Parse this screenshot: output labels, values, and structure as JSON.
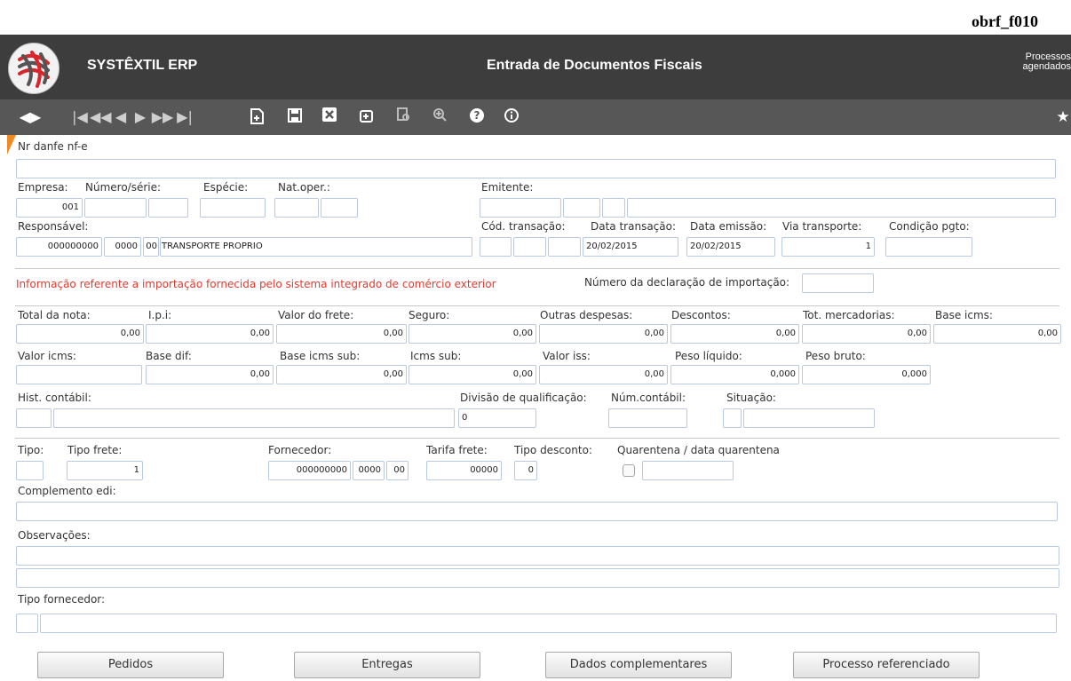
{
  "screen_code": "obrf_f010",
  "header": {
    "brand": "SYSTÊXTIL ERP",
    "title": "Entrada de Documentos Fiscais",
    "processes_line1": "Processos",
    "processes_line2": "agendados"
  },
  "toolbar": {
    "icons": [
      "nav-prev-next-icon",
      "first-record-icon",
      "prev-page-icon",
      "prev-record-icon",
      "next-record-icon",
      "next-page-icon",
      "last-record-icon",
      "new-record-icon",
      "save-icon",
      "delete-icon",
      "add-detail-icon",
      "report-icon",
      "zoom-icon",
      "help-icon",
      "info-icon",
      "favorite-star-icon"
    ]
  },
  "form": {
    "nr_danfe": {
      "label": "Nr danfe nf-e",
      "value": ""
    },
    "empresa": {
      "label": "Empresa:",
      "value": "001"
    },
    "numero_serie": {
      "label": "Número/série:"
    },
    "especie": {
      "label": "Espécie:"
    },
    "nat_oper": {
      "label": "Nat.oper.:"
    },
    "emitente": {
      "label": "Emitente:"
    },
    "responsavel": {
      "label": "Responsável:",
      "code": "000000000",
      "sub": "0000",
      "seq": "00",
      "name": "TRANSPORTE PROPRIO"
    },
    "cod_transacao": {
      "label": "Cód. transação:"
    },
    "data_transacao": {
      "label": "Data transação:",
      "value": "20/02/2015"
    },
    "data_emissao": {
      "label": "Data emissão:",
      "value": "20/02/2015"
    },
    "via_transporte": {
      "label": "Via transporte:",
      "value": "1"
    },
    "condicao_pgto": {
      "label": "Condição pgto:"
    },
    "import_warning": "Informação referente a importação fornecida pelo sistema integrado de comércio exterior",
    "num_declaracao": {
      "label": "Número da declaração de importação:"
    },
    "total_nota": {
      "label": "Total da nota:",
      "value": "0,00"
    },
    "ipi": {
      "label": "I.p.i:",
      "value": "0,00"
    },
    "valor_frete": {
      "label": "Valor do frete:",
      "value": "0,00"
    },
    "seguro": {
      "label": "Seguro:",
      "value": "0,00"
    },
    "outras_despesas": {
      "label": "Outras despesas:",
      "value": "0,00"
    },
    "descontos": {
      "label": "Descontos:",
      "value": "0,00"
    },
    "tot_mercadorias": {
      "label": "Tot. mercadorias:",
      "value": "0,00"
    },
    "base_icms": {
      "label": "Base icms:",
      "value": "0,00"
    },
    "valor_icms": {
      "label": "Valor icms:"
    },
    "base_dif": {
      "label": "Base dif:",
      "value": "0,00"
    },
    "base_icms_sub": {
      "label": "Base icms sub:",
      "value": "0,00"
    },
    "icms_sub": {
      "label": "Icms sub:",
      "value": "0,00"
    },
    "valor_iss": {
      "label": "Valor iss:",
      "value": "0,00"
    },
    "peso_liquido": {
      "label": "Peso líquido:",
      "value": "0,000"
    },
    "peso_bruto": {
      "label": "Peso bruto:",
      "value": "0,000"
    },
    "hist_contabil": {
      "label": "Hist. contábil:"
    },
    "divisao_qualificacao": {
      "label": "Divisão de qualificação:",
      "value": "0"
    },
    "num_contabil": {
      "label": "Núm.contábil:"
    },
    "situacao": {
      "label": "Situação:"
    },
    "tipo": {
      "label": "Tipo:"
    },
    "tipo_frete": {
      "label": "Tipo frete:",
      "value": "1"
    },
    "fornecedor": {
      "label": "Fornecedor:",
      "code": "000000000",
      "sub": "0000",
      "seq": "00"
    },
    "tarifa_frete": {
      "label": "Tarifa frete:",
      "value": "00000"
    },
    "tipo_desconto": {
      "label": "Tipo desconto:",
      "value": "0"
    },
    "quarentena": {
      "label": "Quarentena / data quarentena"
    },
    "complemento_edi": {
      "label": "Complemento edi:"
    },
    "observacoes": {
      "label": "Observações:"
    },
    "tipo_fornecedor": {
      "label": "Tipo fornecedor:"
    }
  },
  "buttons": {
    "pedidos": "Pedidos",
    "entregas": "Entregas",
    "dados_complementares": "Dados complementares",
    "processo_referenciado": "Processo referenciado"
  }
}
